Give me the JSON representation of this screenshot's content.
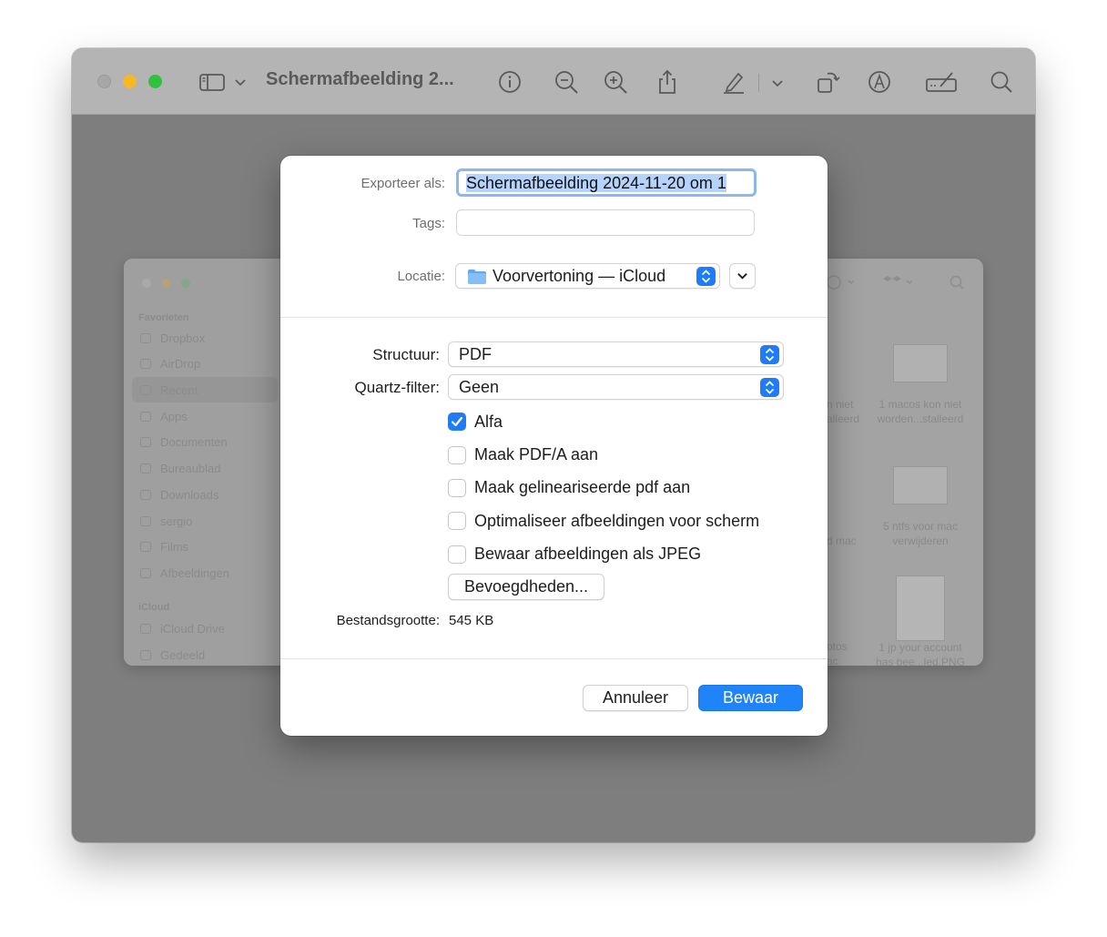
{
  "window": {
    "title": "Schermafbeelding 2...",
    "toolbar_icons": [
      "sidebar-icon",
      "chevron-down-icon",
      "info-icon",
      "zoom-out-icon",
      "zoom-in-icon",
      "share-icon",
      "markup-pen-icon",
      "chevron-down-icon",
      "rotate-icon",
      "markup-circle-icon",
      "form-icon",
      "search-icon"
    ]
  },
  "finder": {
    "sidebar": {
      "favorites_header": "Favorieten",
      "favorites": [
        "Dropbox",
        "AirDrop",
        "Recent",
        "Apps",
        "Documenten",
        "Bureaublad",
        "Downloads",
        "sergio",
        "Films",
        "Afbeeldingen"
      ],
      "icloud_header": "iCloud",
      "icloud": [
        "iCloud Drive",
        "Gedeeld"
      ]
    },
    "grid": {
      "partial_labels": [
        [
          "n niet",
          "alleerd"
        ],
        [
          "d mac"
        ],
        [
          "otos",
          "ac"
        ]
      ],
      "items": [
        {
          "line1": "1 macos kon niet",
          "line2": "worden...stalleerd"
        },
        {
          "line1": "5 ntfs voor mac",
          "line2": "verwijderen"
        },
        {
          "line1": "1 jp your account",
          "line2": "has bee...led.PNG"
        }
      ]
    }
  },
  "sheet": {
    "export_label": "Exporteer als:",
    "export_value": "Schermafbeelding 2024-11-20 om 1",
    "tags_label": "Tags:",
    "tags_value": "",
    "location_label": "Locatie:",
    "location_value": "Voorvertoning — iCloud",
    "format_label": "Structuur:",
    "format_value": "PDF",
    "filter_label": "Quartz-filter:",
    "filter_value": "Geen",
    "options": [
      {
        "label": "Alfa",
        "checked": true
      },
      {
        "label": "Maak PDF/A aan",
        "checked": false
      },
      {
        "label": "Maak gelineariseerde pdf aan",
        "checked": false
      },
      {
        "label": "Optimaliseer afbeeldingen voor scherm",
        "checked": false
      },
      {
        "label": "Bewaar afbeeldingen als JPEG",
        "checked": false
      }
    ],
    "permissions_button": "Bevoegdheden...",
    "filesize_label": "Bestandsgrootte:",
    "filesize_value": "545 KB",
    "cancel_button": "Annuleer",
    "save_button": "Bewaar"
  },
  "colors": {
    "accent": "#1f7cf5",
    "traffic_minimize": "#f7b824",
    "traffic_maximize": "#2ec23d"
  }
}
